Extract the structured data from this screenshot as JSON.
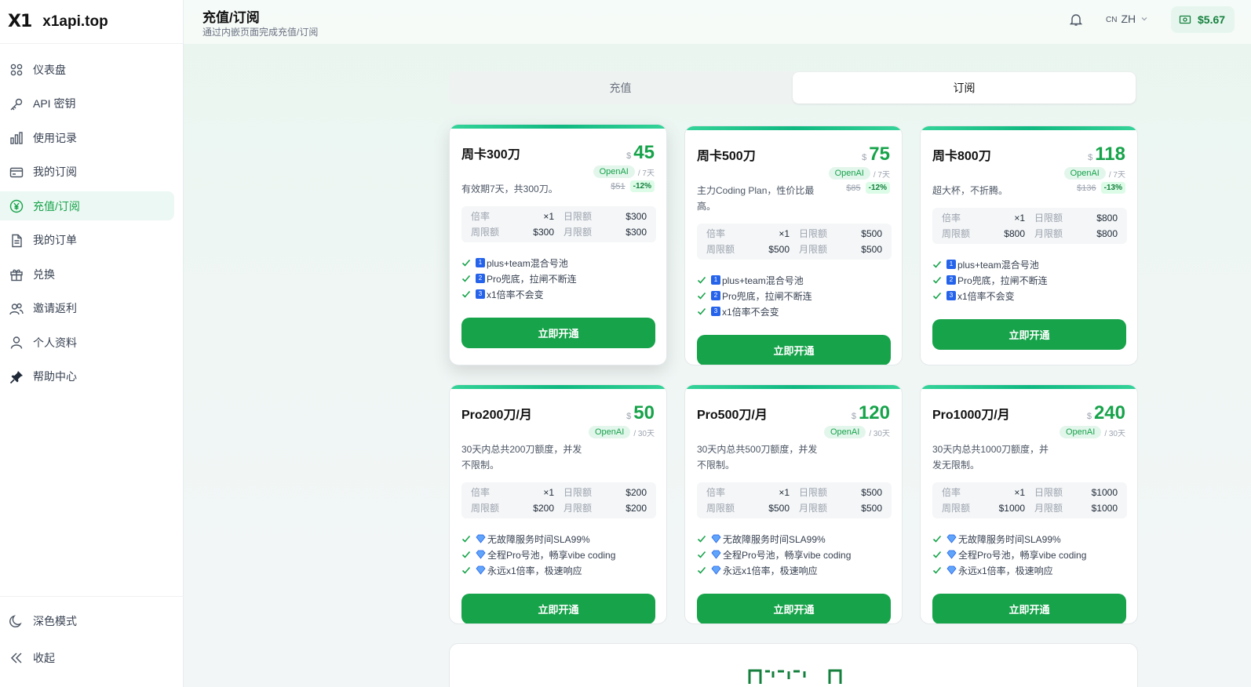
{
  "brand": {
    "logo": "X1",
    "name": "x1api.top"
  },
  "sidebar": {
    "items": [
      {
        "label": "仪表盘",
        "icon": "dashboard-icon"
      },
      {
        "label": "API 密钥",
        "icon": "key-icon"
      },
      {
        "label": "使用记录",
        "icon": "bar-chart-icon"
      },
      {
        "label": "我的订阅",
        "icon": "card-icon"
      },
      {
        "label": "充值/订阅",
        "icon": "yen-circle-icon",
        "active": true
      },
      {
        "label": "我的订单",
        "icon": "document-icon"
      },
      {
        "label": "兑换",
        "icon": "gift-icon"
      },
      {
        "label": "邀请返利",
        "icon": "users-icon"
      },
      {
        "label": "个人资料",
        "icon": "user-icon"
      },
      {
        "label": "帮助中心",
        "icon": "pin-icon"
      }
    ],
    "dark_mode": "深色模式",
    "collapse": "收起"
  },
  "header": {
    "title": "充值/订阅",
    "subtitle": "通过内嵌页面完成充值/订阅",
    "lang_code": "CN",
    "lang": "ZH",
    "balance": "$5.67"
  },
  "tabs": [
    {
      "label": "充值",
      "active": false
    },
    {
      "label": "订阅",
      "active": true
    }
  ],
  "plans": [
    {
      "name": "周卡300刀",
      "currency": "$",
      "price": "45",
      "provider": "OpenAI",
      "period": "/ 7天",
      "original": "$51",
      "discount": "-12%",
      "desc": "有效期7天，共300刀。",
      "stats": {
        "rate_label": "倍率",
        "rate": "×1",
        "daily_label": "日限额",
        "daily": "$300",
        "weekly_label": "周限额",
        "weekly": "$300",
        "monthly_label": "月限额",
        "monthly": "$300"
      },
      "features": [
        {
          "num": "1",
          "text": "plus+team混合号池"
        },
        {
          "num": "2",
          "text": "Pro兜底，拉闸不断连"
        },
        {
          "num": "3",
          "text": "x1倍率不会变"
        }
      ],
      "cta": "立即开通"
    },
    {
      "name": "周卡500刀",
      "currency": "$",
      "price": "75",
      "provider": "OpenAI",
      "period": "/ 7天",
      "original": "$85",
      "discount": "-12%",
      "desc": "主力Coding Plan，性价比最高。",
      "stats": {
        "rate_label": "倍率",
        "rate": "×1",
        "daily_label": "日限额",
        "daily": "$500",
        "weekly_label": "周限额",
        "weekly": "$500",
        "monthly_label": "月限额",
        "monthly": "$500"
      },
      "features": [
        {
          "num": "1",
          "text": "plus+team混合号池"
        },
        {
          "num": "2",
          "text": "Pro兜底，拉闸不断连"
        },
        {
          "num": "3",
          "text": "x1倍率不会变"
        }
      ],
      "cta": "立即开通"
    },
    {
      "name": "周卡800刀",
      "currency": "$",
      "price": "118",
      "provider": "OpenAI",
      "period": "/ 7天",
      "original": "$136",
      "discount": "-13%",
      "desc": "超大杯，不折腾。",
      "stats": {
        "rate_label": "倍率",
        "rate": "×1",
        "daily_label": "日限额",
        "daily": "$800",
        "weekly_label": "周限额",
        "weekly": "$800",
        "monthly_label": "月限额",
        "monthly": "$800"
      },
      "features": [
        {
          "num": "1",
          "text": "plus+team混合号池"
        },
        {
          "num": "2",
          "text": "Pro兜底，拉闸不断连"
        },
        {
          "num": "3",
          "text": "x1倍率不会变"
        }
      ],
      "cta": "立即开通"
    },
    {
      "name": "Pro200刀/月",
      "currency": "$",
      "price": "50",
      "provider": "OpenAI",
      "period": "/ 30天",
      "desc": "30天内总共200刀额度，并发不限制。",
      "stats": {
        "rate_label": "倍率",
        "rate": "×1",
        "daily_label": "日限额",
        "daily": "$200",
        "weekly_label": "周限额",
        "weekly": "$200",
        "monthly_label": "月限额",
        "monthly": "$200"
      },
      "features": [
        {
          "text": "无故障服务时间SLA99%"
        },
        {
          "text": "全程Pro号池，畅享vibe coding"
        },
        {
          "text": "永远x1倍率，极速响应"
        }
      ],
      "cta": "立即开通"
    },
    {
      "name": "Pro500刀/月",
      "currency": "$",
      "price": "120",
      "provider": "OpenAI",
      "period": "/ 30天",
      "desc": "30天内总共500刀额度，并发不限制。",
      "stats": {
        "rate_label": "倍率",
        "rate": "×1",
        "daily_label": "日限额",
        "daily": "$500",
        "weekly_label": "周限额",
        "weekly": "$500",
        "monthly_label": "月限额",
        "monthly": "$500"
      },
      "features": [
        {
          "text": "无故障服务时间SLA99%"
        },
        {
          "text": "全程Pro号池，畅享vibe coding"
        },
        {
          "text": "永远x1倍率，极速响应"
        }
      ],
      "cta": "立即开通"
    },
    {
      "name": "Pro1000刀/月",
      "currency": "$",
      "price": "240",
      "provider": "OpenAI",
      "period": "/ 30天",
      "desc": "30天内总共1000刀额度，并发无限制。",
      "stats": {
        "rate_label": "倍率",
        "rate": "×1",
        "daily_label": "日限额",
        "daily": "$1000",
        "weekly_label": "周限额",
        "weekly": "$1000",
        "monthly_label": "月限额",
        "monthly": "$1000"
      },
      "features": [
        {
          "text": "无故障服务时间SLA99%"
        },
        {
          "text": "全程Pro号池，畅享vibe coding"
        },
        {
          "text": "永远x1倍率，极速响应"
        }
      ],
      "cta": "立即开通"
    }
  ]
}
